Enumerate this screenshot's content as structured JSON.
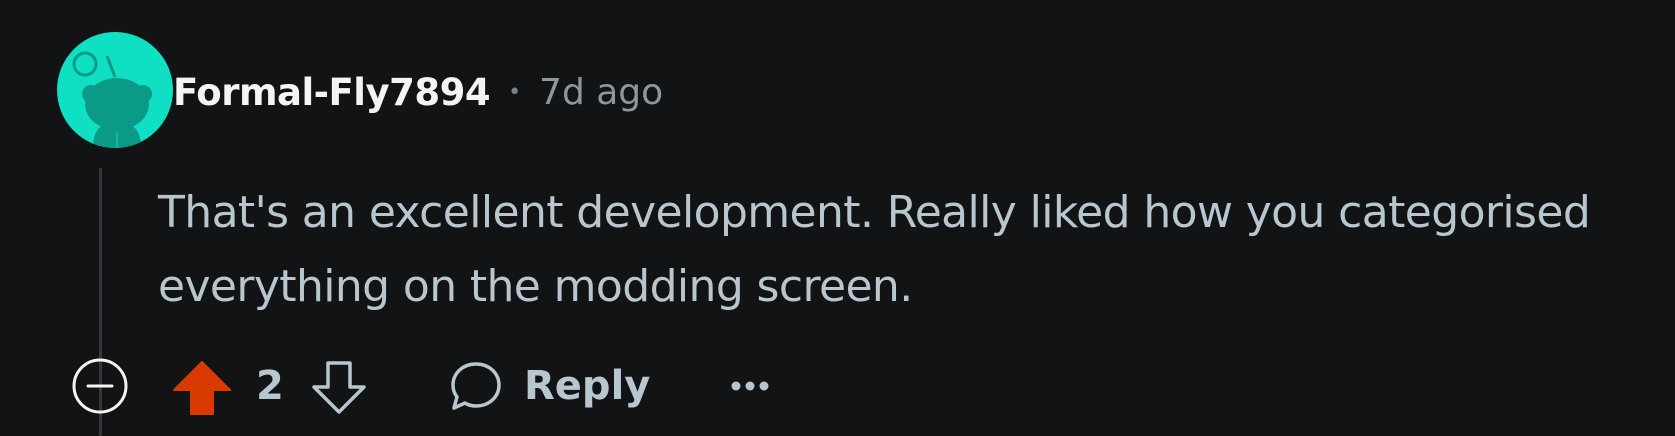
{
  "comment": {
    "author": "Formal-Fly7894",
    "separator": "•",
    "age": "7d ago",
    "text": "That's an excellent development. Really liked how you categorised everything on the modding screen."
  },
  "actions": {
    "collapse_icon": "collapse-circle-minus-icon",
    "upvote_icon": "upvote-arrow-icon",
    "vote_count": "2",
    "downvote_icon": "downvote-arrow-icon",
    "reply_icon": "speech-bubble-icon",
    "reply_label": "Reply",
    "more_icon": "more-dots-icon"
  },
  "colors": {
    "background": "#111315",
    "avatar": "#0fe0c4",
    "upvote_active": "#d93a00",
    "text": "#b7c6cf"
  }
}
